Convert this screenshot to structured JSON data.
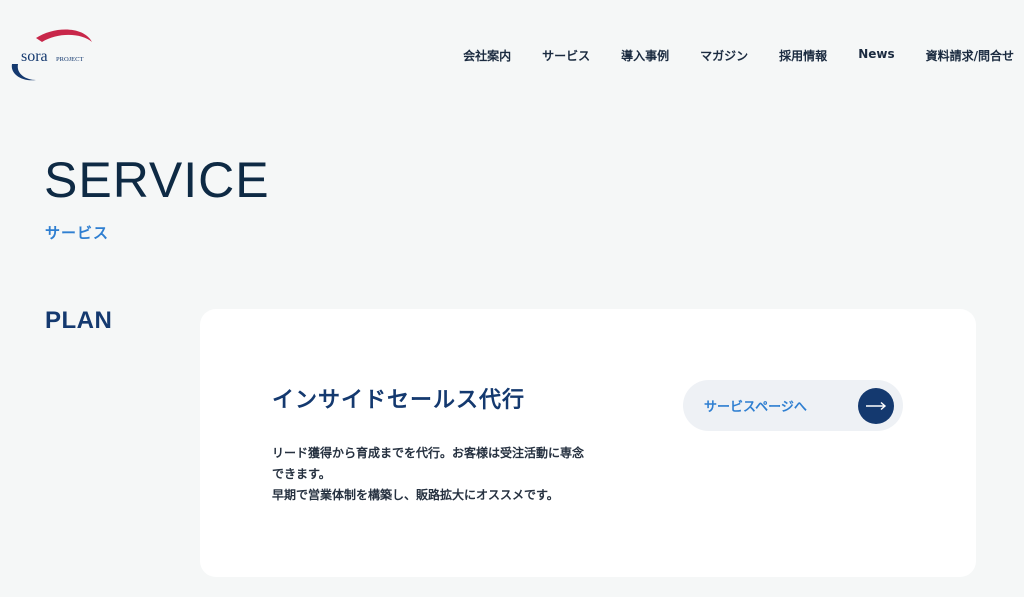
{
  "logo": {
    "text_main": "sora",
    "text_sub": "PROJECT"
  },
  "nav": {
    "items": [
      {
        "label": "会社案内"
      },
      {
        "label": "サービス"
      },
      {
        "label": "導入事例"
      },
      {
        "label": "マガジン"
      },
      {
        "label": "採用情報"
      },
      {
        "label": "News"
      },
      {
        "label": "資料請求/問合せ"
      }
    ]
  },
  "hero": {
    "title": "SERVICE",
    "subtitle": "サービス"
  },
  "plan": {
    "label": "PLAN"
  },
  "card": {
    "title": "インサイドセールス代行",
    "description": {
      "line1": "リード獲得から育成までを代行。お客様は受注活動に専念",
      "line2": "できます。",
      "line3": "早期で営業体制を構築し、販路拡大にオススメです。"
    },
    "button_label": "サービスページへ",
    "button_icon": "arrow-right-icon"
  },
  "colors": {
    "background": "#f5f7f7",
    "navy": "#14396f",
    "accent_blue": "#2f7fd1",
    "logo_red": "#c8274a"
  }
}
